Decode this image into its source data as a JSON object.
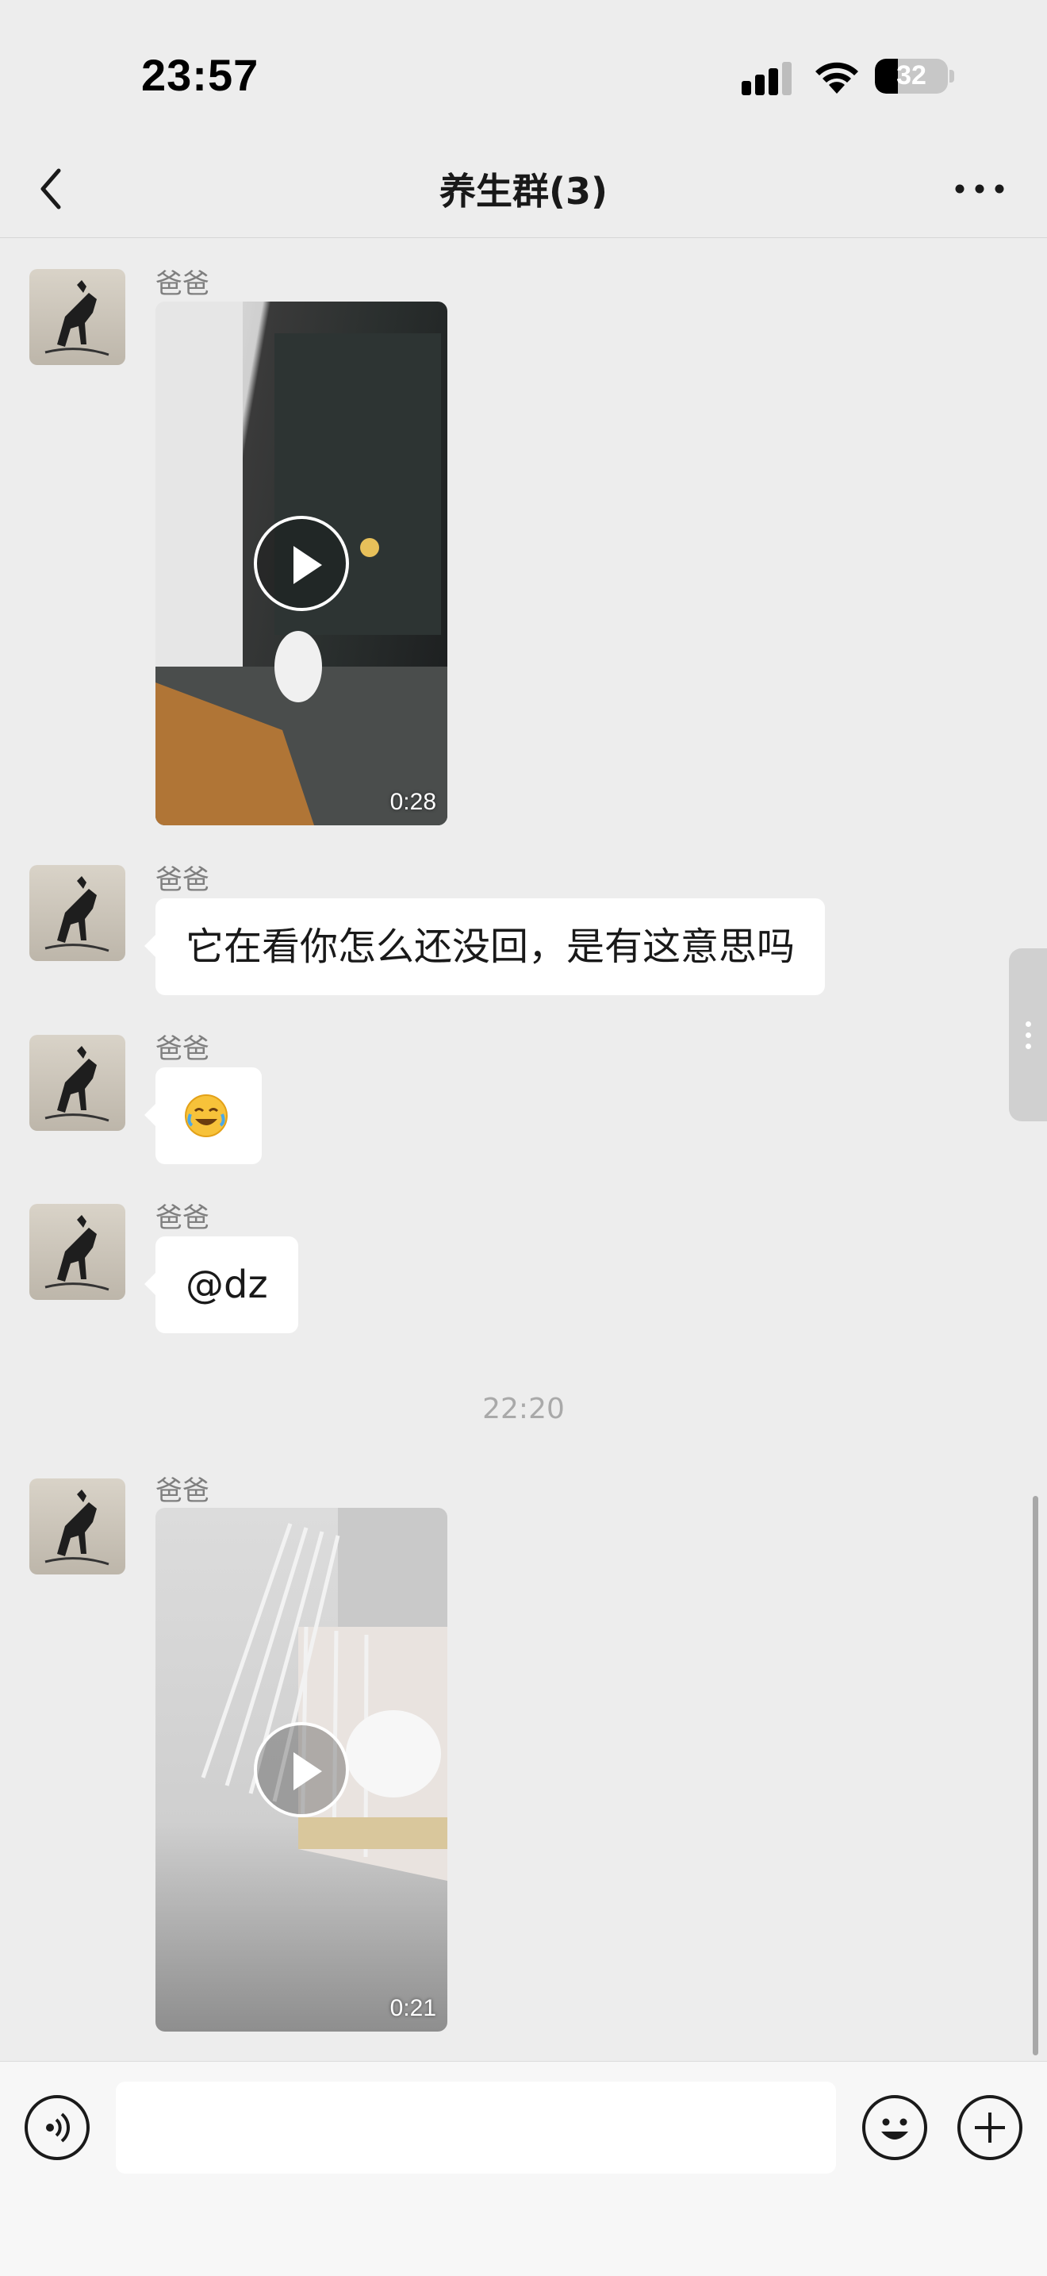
{
  "status_bar": {
    "time": "23:57",
    "battery": "32",
    "battery_level": 0.32
  },
  "chat": {
    "title": "养生群(3)"
  },
  "messages": [
    {
      "type": "video",
      "sender": "爸爸",
      "duration": "0:28"
    },
    {
      "type": "text",
      "sender": "爸爸",
      "text": "它在看你怎么还没回，是有这意思吗"
    },
    {
      "type": "emoji",
      "sender": "爸爸",
      "emoji": "crying-laughing-emoji"
    },
    {
      "type": "text",
      "sender": "爸爸",
      "text": "@dz"
    },
    {
      "type": "timestamp",
      "text": "22:20"
    },
    {
      "type": "video",
      "sender": "爸爸",
      "duration": "0:21"
    }
  ],
  "input": {
    "placeholder": "",
    "value": ""
  },
  "icons": [
    "back-icon",
    "more-icon",
    "voice-icon",
    "emoji-icon",
    "plus-icon"
  ],
  "colors": {
    "background": "#ededed",
    "bubble": "#ffffff",
    "accent": "#191919"
  }
}
